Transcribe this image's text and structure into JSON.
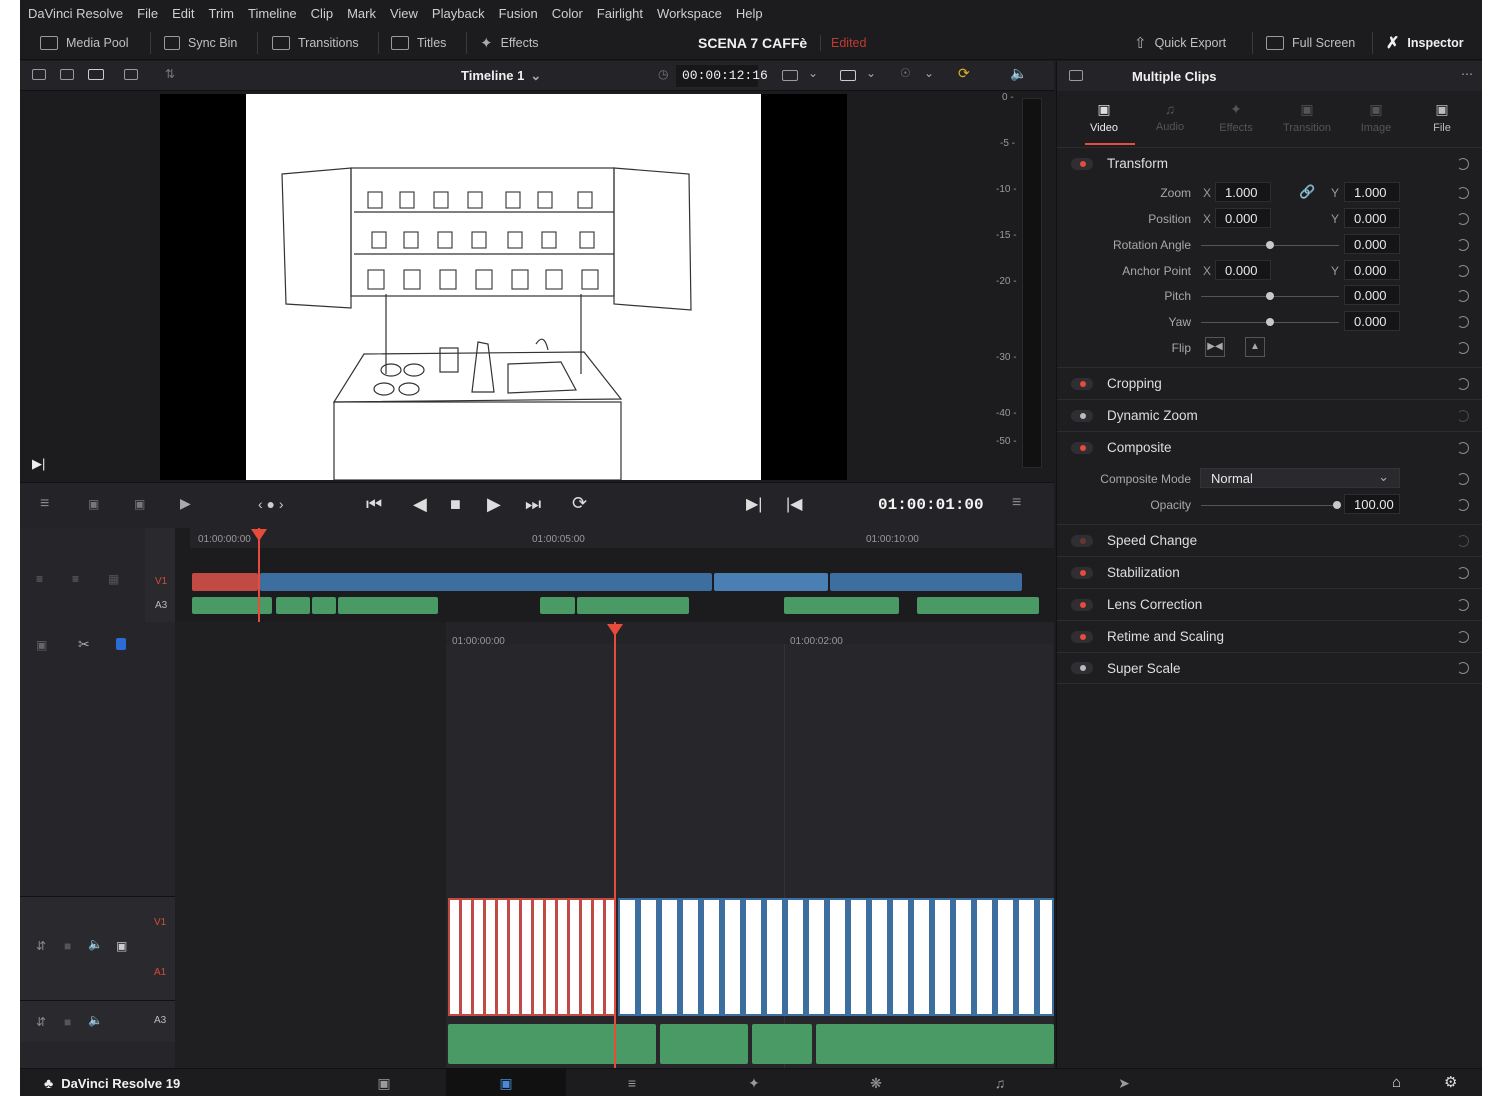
{
  "menu": [
    "DaVinci Resolve",
    "File",
    "Edit",
    "Trim",
    "Timeline",
    "Clip",
    "Mark",
    "View",
    "Playback",
    "Fusion",
    "Color",
    "Fairlight",
    "Workspace",
    "Help"
  ],
  "toolbar": {
    "media_pool": "Media Pool",
    "sync_bin": "Sync Bin",
    "transitions": "Transitions",
    "titles": "Titles",
    "effects": "Effects",
    "project_title": "SCENA 7 CAFFè",
    "project_status": "Edited",
    "quick_export": "Quick Export",
    "full_screen": "Full Screen",
    "inspector": "Inspector"
  },
  "viewer": {
    "timeline_name": "Timeline 1",
    "timecode_duration": "00:00:12:16",
    "playhead_timecode": "01:00:01:00",
    "meter_scale": [
      "0 -",
      "-5 -",
      "-10 -",
      "-15 -",
      "-20 -",
      "-30 -",
      "-40 -",
      "-50 -"
    ]
  },
  "timeline_upper": {
    "ruler": [
      "01:00:00:00",
      "01:00:05:00",
      "01:00:10:00"
    ],
    "tracks": [
      "V1",
      "A3"
    ]
  },
  "timeline_lower": {
    "ruler": [
      "01:00:00:00",
      "01:00:02:00"
    ],
    "tracks": [
      "V1",
      "A1",
      "A3"
    ]
  },
  "inspector": {
    "title": "Multiple Clips",
    "tabs": [
      "Video",
      "Audio",
      "Effects",
      "Transition",
      "Image",
      "File"
    ],
    "active_tab": "Video",
    "transform": {
      "title": "Transform",
      "zoom_label": "Zoom",
      "zoom_x": "1.000",
      "zoom_y": "1.000",
      "position_label": "Position",
      "position_x": "0.000",
      "position_y": "0.000",
      "rotation_label": "Rotation Angle",
      "rotation": "0.000",
      "anchor_label": "Anchor Point",
      "anchor_x": "0.000",
      "anchor_y": "0.000",
      "pitch_label": "Pitch",
      "pitch": "0.000",
      "yaw_label": "Yaw",
      "yaw": "0.000",
      "flip_label": "Flip",
      "x": "X",
      "y": "Y"
    },
    "cropping": "Cropping",
    "dynamic_zoom": "Dynamic Zoom",
    "composite": {
      "title": "Composite",
      "mode_label": "Composite Mode",
      "mode_value": "Normal",
      "opacity_label": "Opacity",
      "opacity_value": "100.00"
    },
    "speed_change": "Speed Change",
    "stabilization": "Stabilization",
    "lens_correction": "Lens Correction",
    "retime_scaling": "Retime and Scaling",
    "super_scale": "Super Scale"
  },
  "bottom": {
    "app_name": "DaVinci Resolve 19"
  },
  "colors": {
    "accent": "#e64b3c",
    "clip_video": "#3c6f9f",
    "clip_audio": "#4a9a66"
  }
}
